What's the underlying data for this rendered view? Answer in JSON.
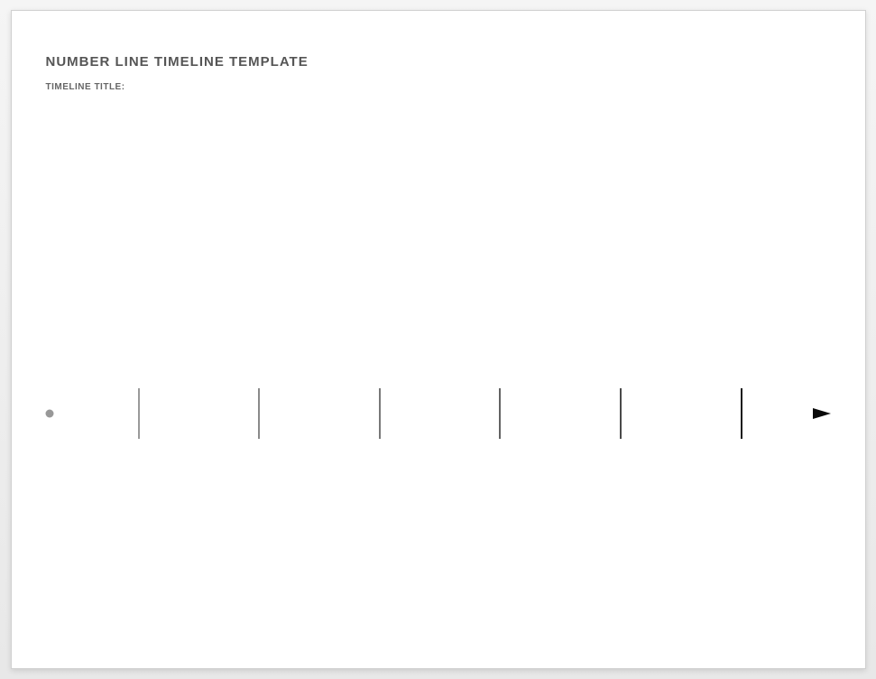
{
  "header": {
    "title": "NUMBER LINE TIMELINE TEMPLATE",
    "subtitle_label": "TIMELINE TITLE:"
  },
  "timeline": {
    "ticks": [
      {
        "positionPct": 11.5,
        "color": "#9a9a9a"
      },
      {
        "positionPct": 27.0,
        "color": "#8a8a8a"
      },
      {
        "positionPct": 42.5,
        "color": "#787878"
      },
      {
        "positionPct": 58.0,
        "color": "#636363"
      },
      {
        "positionPct": 73.5,
        "color": "#4a4a4a"
      },
      {
        "positionPct": 89.0,
        "color": "#1a1a1a"
      }
    ],
    "gradient": {
      "start": "#9e9e9e",
      "end": "#0a0a0a"
    }
  }
}
